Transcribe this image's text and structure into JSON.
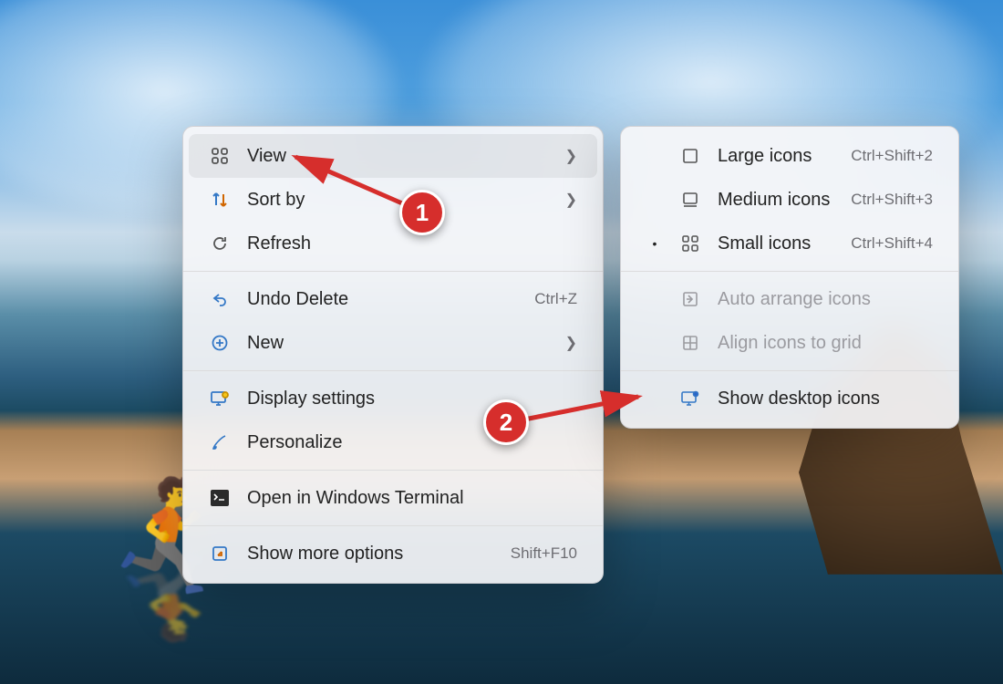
{
  "main_menu": {
    "view": {
      "label": "View",
      "accel": "",
      "submenu": true
    },
    "sort": {
      "label": "Sort by",
      "accel": "",
      "submenu": true
    },
    "refresh": {
      "label": "Refresh",
      "accel": ""
    },
    "undo": {
      "label": "Undo Delete",
      "accel": "Ctrl+Z"
    },
    "new": {
      "label": "New",
      "accel": "",
      "submenu": true
    },
    "display": {
      "label": "Display settings",
      "accel": ""
    },
    "personalize": {
      "label": "Personalize",
      "accel": ""
    },
    "terminal": {
      "label": "Open in Windows Terminal",
      "accel": ""
    },
    "more": {
      "label": "Show more options",
      "accel": "Shift+F10"
    }
  },
  "view_submenu": {
    "large": {
      "label": "Large icons",
      "accel": "Ctrl+Shift+2",
      "selected": false
    },
    "medium": {
      "label": "Medium icons",
      "accel": "Ctrl+Shift+3",
      "selected": false
    },
    "small": {
      "label": "Small icons",
      "accel": "Ctrl+Shift+4",
      "selected": true
    },
    "auto": {
      "label": "Auto arrange icons",
      "enabled": false
    },
    "align": {
      "label": "Align icons to grid",
      "enabled": false
    },
    "show": {
      "label": "Show desktop icons",
      "enabled": true
    }
  },
  "callouts": {
    "c1": "1",
    "c2": "2"
  },
  "icons": {
    "grid2x2": "grid-icon",
    "sort": "sort-icon",
    "refresh": "refresh-icon",
    "undo": "undo-icon",
    "plus": "plus-circle-icon",
    "monitor": "display-settings-icon",
    "brush": "personalize-icon",
    "terminal": "terminal-icon",
    "expand": "expand-icon",
    "large": "large-icons-icon",
    "medium": "medium-icons-icon",
    "small": "small-icons-icon",
    "auto": "auto-arrange-icon",
    "align": "align-grid-icon",
    "desktop": "desktop-icon"
  },
  "colors": {
    "accent": "#3478c6",
    "callout": "#d62e2c"
  }
}
